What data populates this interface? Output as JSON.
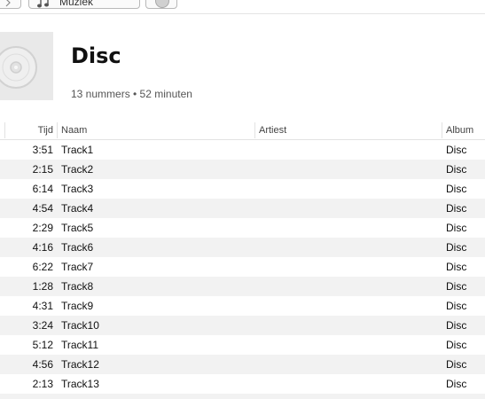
{
  "toolbar": {
    "source_label": "Muziek"
  },
  "album": {
    "title": "Disc",
    "meta": "13 nummers • 52 minuten"
  },
  "columns": {
    "time": "Tijd",
    "name": "Naam",
    "artist": "Artiest",
    "album": "Album"
  },
  "tracks": [
    {
      "time": "3:51",
      "name": "Track1",
      "artist": "",
      "album": "Disc"
    },
    {
      "time": "2:15",
      "name": "Track2",
      "artist": "",
      "album": "Disc"
    },
    {
      "time": "6:14",
      "name": "Track3",
      "artist": "",
      "album": "Disc"
    },
    {
      "time": "4:54",
      "name": "Track4",
      "artist": "",
      "album": "Disc"
    },
    {
      "time": "2:29",
      "name": "Track5",
      "artist": "",
      "album": "Disc"
    },
    {
      "time": "4:16",
      "name": "Track6",
      "artist": "",
      "album": "Disc"
    },
    {
      "time": "6:22",
      "name": "Track7",
      "artist": "",
      "album": "Disc"
    },
    {
      "time": "1:28",
      "name": "Track8",
      "artist": "",
      "album": "Disc"
    },
    {
      "time": "4:31",
      "name": "Track9",
      "artist": "",
      "album": "Disc"
    },
    {
      "time": "3:24",
      "name": "Track10",
      "artist": "",
      "album": "Disc"
    },
    {
      "time": "5:12",
      "name": "Track11",
      "artist": "",
      "album": "Disc"
    },
    {
      "time": "4:56",
      "name": "Track12",
      "artist": "",
      "album": "Disc"
    },
    {
      "time": "2:13",
      "name": "Track13",
      "artist": "",
      "album": "Disc"
    }
  ]
}
